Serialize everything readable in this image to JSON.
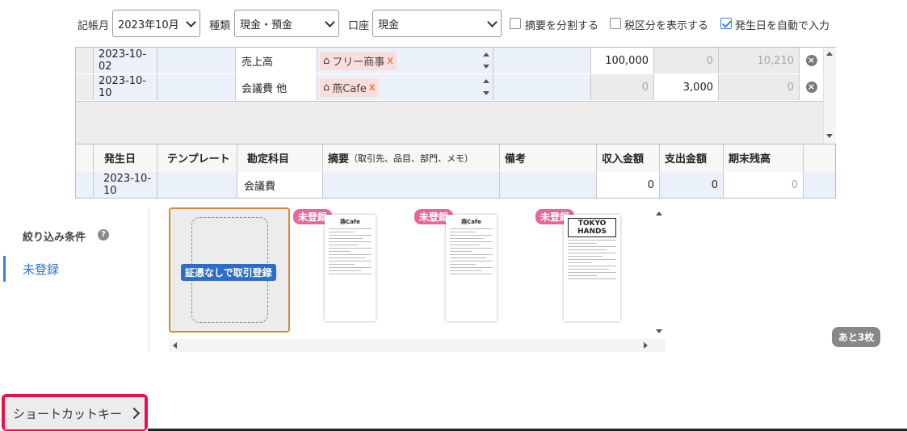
{
  "filters": {
    "month_label": "記帳月",
    "month_value": "2023年10月",
    "type_label": "種類",
    "type_value": "現金・預金",
    "account_label": "口座",
    "account_value": "現金",
    "split_summary": "摘要を分割する",
    "show_tax": "税区分を表示する",
    "auto_date": "発生日を自動で入力"
  },
  "rows": [
    {
      "date": "2023-10-02",
      "template": "",
      "account": "売上高",
      "tag": "フリー商事",
      "memo": "",
      "income": "100,000",
      "expense": "0",
      "balance": "10,210"
    },
    {
      "date": "2023-10-10",
      "template": "",
      "account": "会議費 他",
      "tag": "燕Cafe",
      "memo": "",
      "income": "0",
      "expense": "3,000",
      "balance": "0"
    }
  ],
  "tag_remove": "x",
  "headers": {
    "date": "発生日",
    "template": "テンプレート",
    "account": "勘定科目",
    "summary": "摘要",
    "summary_hint": "（取引先、品目、部門、メモ）",
    "memo": "備考",
    "income": "収入金額",
    "expense": "支出金額",
    "balance": "期末残高"
  },
  "input_row": {
    "date": "2023-10-10",
    "template": "",
    "account": "会議費",
    "summary": "",
    "memo": "",
    "income": "0",
    "expense": "0",
    "balance": "0"
  },
  "sidebar": {
    "filter_title": "絞り込み条件",
    "help_icon": "?",
    "unregistered": "未登録"
  },
  "receipts": {
    "no_receipt_button": "証憑なしで取引登録",
    "items": [
      {
        "badge": "未登録",
        "store": "燕Cafe"
      },
      {
        "badge": "未登録",
        "store": "燕Cafe"
      },
      {
        "badge": "未登録",
        "store": "TOKYO HANDS"
      }
    ],
    "remaining": "あと3枚"
  },
  "shortcut": {
    "label": "ショートカットキー",
    "icon": "chevron-right-icon"
  },
  "colors": {
    "accent": "#3d7fd8",
    "badge": "#e8669a",
    "highlight": "#e8104a",
    "selected_border": "#d98a2e",
    "tag_bg": "#fadede",
    "row_bg": "#eaf1fb"
  }
}
